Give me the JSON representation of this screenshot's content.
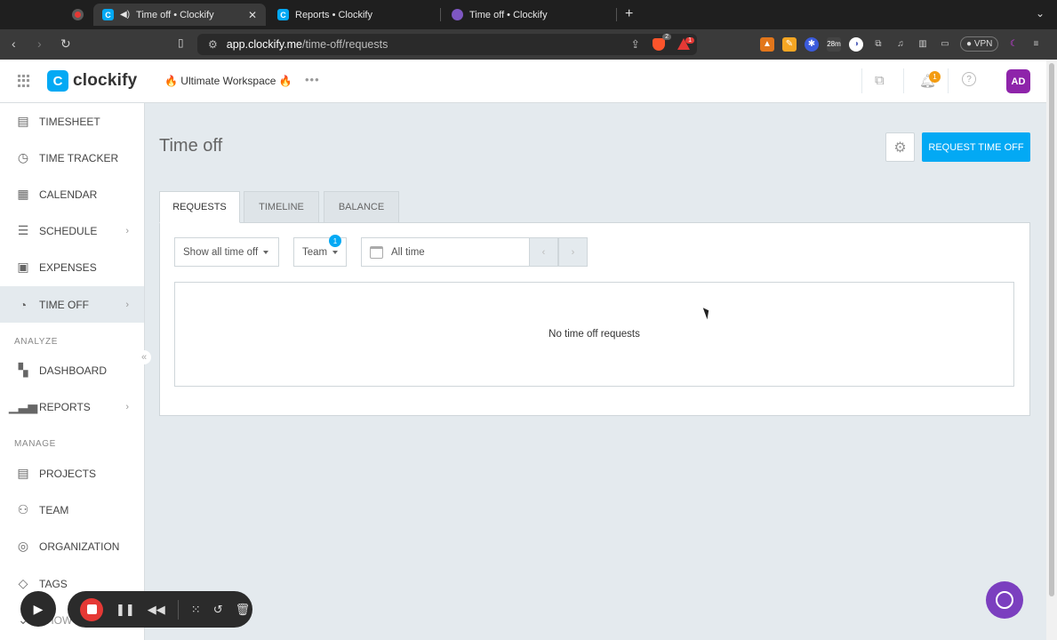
{
  "browser": {
    "tabs": [
      {
        "title": "Time off • Clockify",
        "active": true
      },
      {
        "title": "Reports • Clockify",
        "active": false
      },
      {
        "title": "Time off • Clockify",
        "active": false
      }
    ],
    "url_host": "app.clockify.me",
    "url_path": "/time-off/requests",
    "shield_count": "2",
    "alert_count": "1",
    "timer_ext": "28m",
    "vpn_label": "VPN"
  },
  "header": {
    "logo_text": "clockify",
    "workspace": "🔥 Ultimate Workspace 🔥",
    "notification_count": "1",
    "avatar_initials": "AD"
  },
  "sidebar": {
    "items": [
      {
        "label": "TIMESHEET",
        "icon": "timesheet-icon"
      },
      {
        "label": "TIME TRACKER",
        "icon": "clock-icon"
      },
      {
        "label": "CALENDAR",
        "icon": "calendar-icon"
      },
      {
        "label": "SCHEDULE",
        "icon": "schedule-icon"
      },
      {
        "label": "EXPENSES",
        "icon": "expenses-icon"
      },
      {
        "label": "TIME OFF",
        "icon": "time-off-icon"
      }
    ],
    "analyze_label": "ANALYZE",
    "analyze_items": [
      {
        "label": "DASHBOARD",
        "icon": "dashboard-icon"
      },
      {
        "label": "REPORTS",
        "icon": "reports-icon"
      }
    ],
    "manage_label": "MANAGE",
    "manage_items": [
      {
        "label": "PROJECTS",
        "icon": "projects-icon"
      },
      {
        "label": "TEAM",
        "icon": "team-icon"
      },
      {
        "label": "ORGANIZATION",
        "icon": "organization-icon"
      },
      {
        "label": "TAGS",
        "icon": "tags-icon"
      }
    ],
    "partial_item": "SHOW MORE"
  },
  "main": {
    "title": "Time off",
    "request_button": "REQUEST TIME OFF",
    "tabs": [
      "REQUESTS",
      "TIMELINE",
      "BALANCE"
    ],
    "filters": {
      "status": "Show all time off",
      "team": "Team",
      "team_badge": "1",
      "date_range": "All time"
    },
    "empty_message": "No time off requests"
  },
  "colors": {
    "accent": "#03a9f4",
    "avatar": "#8e24aa",
    "chat": "#7b3fbf",
    "record": "#e53935"
  }
}
